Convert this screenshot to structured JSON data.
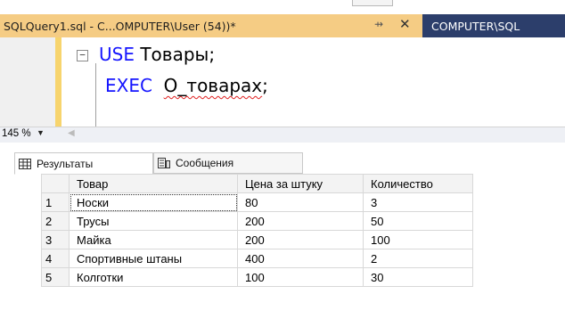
{
  "tabs": {
    "active": {
      "title": "SQLQuery1.sql - C...OMPUTER\\User (54))*",
      "pin": "⇸",
      "close": "✕"
    },
    "inactive": {
      "title": "COMPUTER\\SQL"
    }
  },
  "editor": {
    "collapse_glyph": "−",
    "line1": {
      "keyword": "USE",
      "text": "Товары;"
    },
    "line2": {
      "keyword": "EXEC",
      "procedure": "O_товарах",
      "punct": ";"
    }
  },
  "statusbar": {
    "zoom": "145 %",
    "zoom_arrow": "▼",
    "scroll_left": "◀"
  },
  "results": {
    "tabs": [
      "Результаты",
      "Сообщения"
    ],
    "columns": [
      "Товар",
      "Цена за штуку",
      "Количество"
    ],
    "rows": [
      {
        "num": "1",
        "name": "Носки",
        "price": "80",
        "qty": "3"
      },
      {
        "num": "2",
        "name": "Трусы",
        "price": "200",
        "qty": "50"
      },
      {
        "num": "3",
        "name": "Майка",
        "price": "200",
        "qty": "100"
      },
      {
        "num": "4",
        "name": "Спортивные штаны",
        "price": "400",
        "qty": "2"
      },
      {
        "num": "5",
        "name": "Колготки",
        "price": "100",
        "qty": "30"
      }
    ]
  },
  "colors": {
    "tab_active": "#f5cc84",
    "tabbar": "#2c3e6b",
    "keyword": "#1515ff",
    "change_bar": "#f7d46d"
  }
}
